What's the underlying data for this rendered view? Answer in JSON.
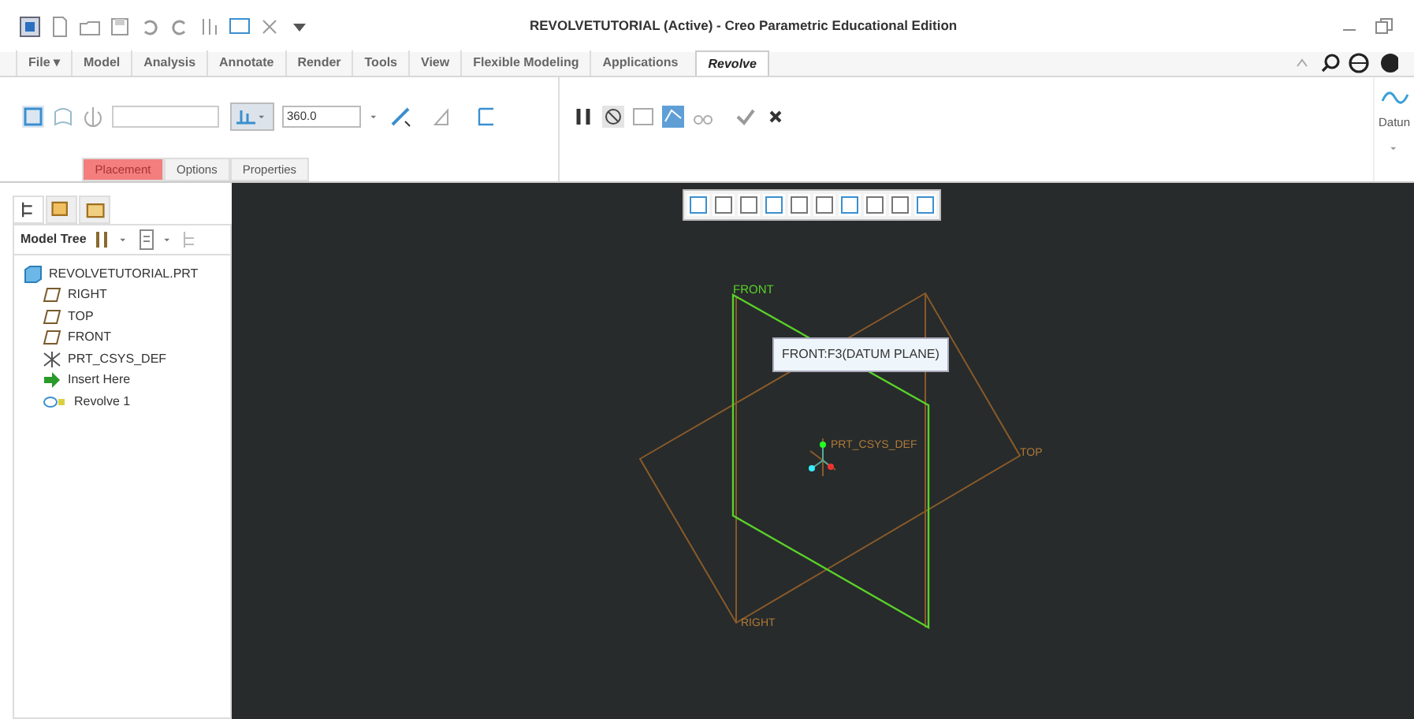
{
  "window": {
    "title": "REVOLVETUTORIAL (Active) - Creo Parametric Educational Edition"
  },
  "ribbon_tabs": [
    {
      "label": "File ▾",
      "selected": false
    },
    {
      "label": "Model",
      "selected": false
    },
    {
      "label": "Analysis",
      "selected": false
    },
    {
      "label": "Annotate",
      "selected": false
    },
    {
      "label": "Render",
      "selected": false
    },
    {
      "label": "Tools",
      "selected": false
    },
    {
      "label": "View",
      "selected": false
    },
    {
      "label": "Flexible Modeling",
      "selected": false
    },
    {
      "label": "Applications",
      "selected": false
    },
    {
      "label": "Revolve",
      "selected": true
    }
  ],
  "revolve_dashboard": {
    "angle_value": "360.0",
    "panel_tabs": [
      {
        "label": "Placement",
        "selected": true
      },
      {
        "label": "Options",
        "selected": false
      },
      {
        "label": "Properties",
        "selected": false
      }
    ],
    "datum_label": "Datun"
  },
  "model_tree": {
    "title": "Model Tree",
    "items": [
      {
        "kind": "part",
        "label": "REVOLVETUTORIAL.PRT",
        "children": [
          {
            "kind": "plane",
            "label": "RIGHT"
          },
          {
            "kind": "plane",
            "label": "TOP"
          },
          {
            "kind": "plane",
            "label": "FRONT"
          },
          {
            "kind": "csys",
            "label": "PRT_CSYS_DEF"
          },
          {
            "kind": "insert",
            "label": "Insert Here"
          },
          {
            "kind": "revolve",
            "label": "Revolve 1"
          }
        ]
      }
    ]
  },
  "viewport": {
    "labels": [
      {
        "kind": "selected",
        "text": "FRONT"
      },
      {
        "kind": "csys",
        "text": "PRT_CSYS_DEF"
      },
      {
        "kind": "plane",
        "text": "TOP"
      },
      {
        "kind": "plane",
        "text": "RIGHT"
      }
    ],
    "tooltip": "FRONT:F3(DATUM PLANE)"
  }
}
